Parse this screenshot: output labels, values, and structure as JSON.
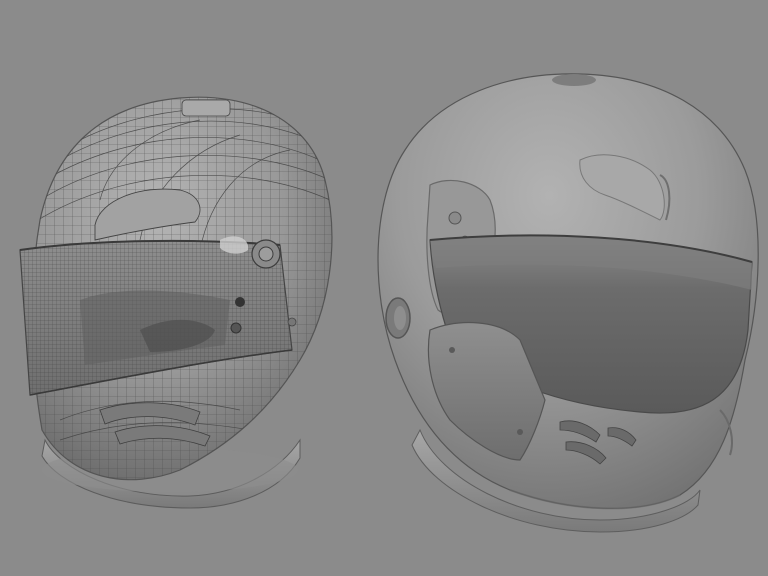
{
  "scene": {
    "background_color": "#8b8b8b",
    "shell_color": "#9a9a9a",
    "shell_shadow_color": "#5e5e5e",
    "visor_color": "#6f6f6f",
    "wire_color": "#4a4a4a",
    "objects": [
      {
        "name": "wireframe-helmet",
        "render_mode": "wireframe-on-shaded"
      },
      {
        "name": "shaded-helmet",
        "render_mode": "smooth-shaded"
      }
    ]
  }
}
